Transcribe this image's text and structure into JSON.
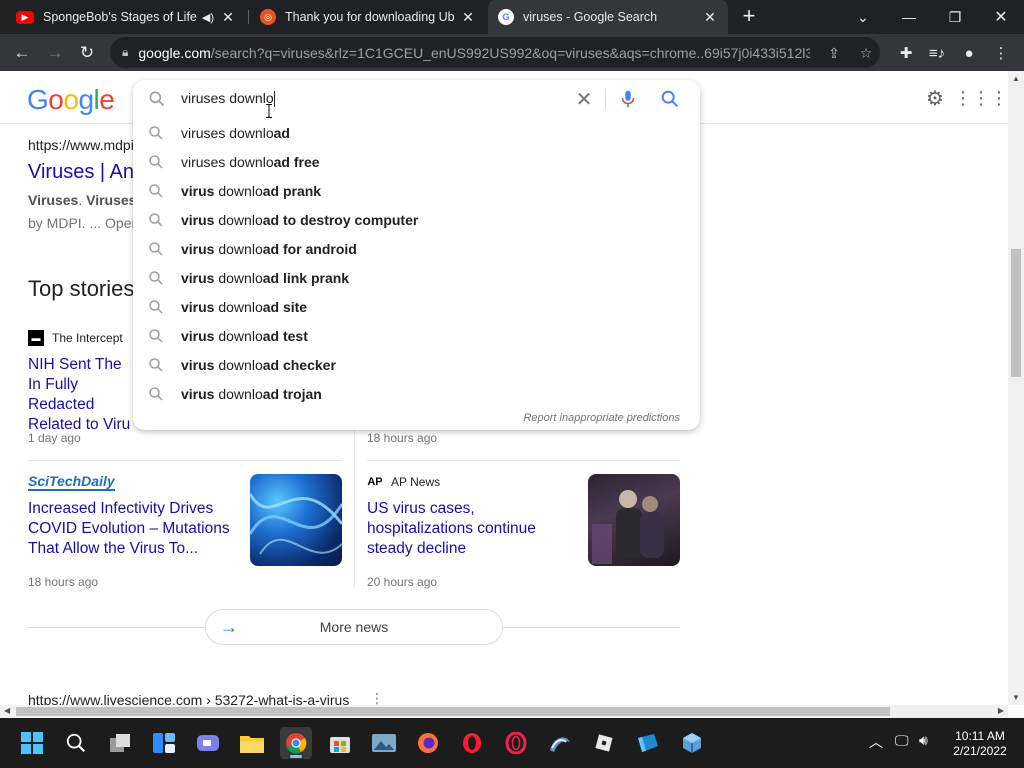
{
  "browser": {
    "tabs": [
      {
        "title": "SpongeBob's Stages of Life! ",
        "favicon": "youtube-icon",
        "audio": true
      },
      {
        "title": "Thank you for downloading Ubun",
        "favicon": "ubuntu-icon"
      },
      {
        "title": "viruses - Google Search",
        "favicon": "google-icon",
        "active": true
      }
    ],
    "url_host": "google.com",
    "url_rest": "/search?q=viruses&rlz=1C1GCEU_enUS992US992&oq=viruses&aqs=chrome..69i57j0i433i512l3...",
    "colors": {
      "frame": "#202124",
      "toolbar": "#35363a"
    }
  },
  "google": {
    "logo_letters": [
      "G",
      "o",
      "o",
      "g",
      "l",
      "e"
    ],
    "search": {
      "query": "viruses downlo",
      "suggestions": [
        {
          "normal": "viruses downlo",
          "bold": "ad"
        },
        {
          "normal": "viruses downlo",
          "bold": "ad free"
        },
        {
          "pre_bold": "virus",
          "normal": " downlo",
          "bold": "ad prank"
        },
        {
          "pre_bold": "virus",
          "normal": " downlo",
          "bold": "ad to destroy computer"
        },
        {
          "pre_bold": "virus",
          "normal": " downlo",
          "bold": "ad for android"
        },
        {
          "pre_bold": "virus",
          "normal": " downlo",
          "bold": "ad link prank"
        },
        {
          "pre_bold": "virus",
          "normal": " downlo",
          "bold": "ad site"
        },
        {
          "pre_bold": "virus",
          "normal": " downlo",
          "bold": "ad test"
        },
        {
          "pre_bold": "virus",
          "normal": " downlo",
          "bold": "ad checker"
        },
        {
          "pre_bold": "virus",
          "normal": " downlo",
          "bold": "ad trojan"
        }
      ],
      "report_link": "Report inappropriate predictions"
    },
    "result1": {
      "url": "https://www.mdpi",
      "title": "Viruses | An",
      "snippet_bold1": "Viruses",
      "snippet_sep": ". ",
      "snippet_bold2": "Viruses",
      "meta": "by MDPI. ... Oper"
    },
    "top_stories_heading": "Top stories",
    "stories": [
      {
        "source": "The Intercept",
        "headline": "NIH Sent The In Fully Redacted Related to Viru",
        "age": "1 day ago"
      },
      {
        "source": "",
        "headline": "",
        "age": "18 hours ago"
      },
      {
        "source": "SciTechDaily",
        "headline": "Increased Infectivity Drives COVID Evolution – Mutations That Allow the Virus To...",
        "age": "18 hours ago"
      },
      {
        "source": "AP News",
        "headline": "US virus cases, hospitalizations continue steady decline",
        "age": "20 hours ago"
      }
    ],
    "more_news": "More news",
    "bottom_url": "https://www.livescience.com › 53272-what-is-a-virus"
  },
  "taskbar": {
    "apps": [
      "windows-start-icon",
      "search-icon",
      "task-view-icon",
      "widgets-icon",
      "teams-chat-icon",
      "file-explorer-icon",
      "chrome-icon",
      "store-icon",
      "photos-icon",
      "firefox-icon",
      "opera-icon",
      "opera-gx-icon",
      "wireshark-icon",
      "roblox-icon",
      "azure-data-studio-icon",
      "virtualbox-icon"
    ],
    "time": "10:11 AM",
    "date": "2/21/2022"
  }
}
